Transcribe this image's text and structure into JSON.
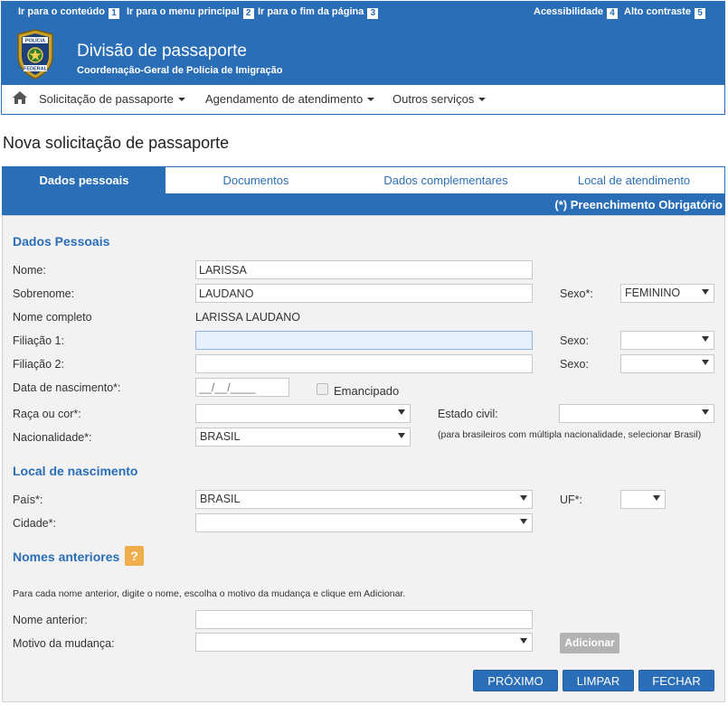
{
  "skip_links": [
    {
      "label": "Ir para o conteúdo",
      "key": "1"
    },
    {
      "label": "Ir para o menu principal",
      "key": "2"
    },
    {
      "label": "Ir para o fim da página",
      "key": "3"
    }
  ],
  "accessibility": {
    "label": "Acessibilidade",
    "key": "4",
    "contrast_label": "Alto contraste",
    "contrast_key": "5"
  },
  "header": {
    "title": "Divisão de passaporte",
    "subtitle": "Coordenação-Geral de Polícia de Imigração",
    "badge_top": "POLÍCIA",
    "badge_bottom": "FEDERAL"
  },
  "nav": {
    "items": [
      "Solicitação de passaporte",
      "Agendamento de atendimento",
      "Outros serviços"
    ]
  },
  "page_title": "Nova solicitação de passaporte",
  "tabs": [
    "Dados pessoais",
    "Documentos",
    "Dados complementares",
    "Local de atendimento"
  ],
  "required_note": "(*) Preenchimento Obrigatório",
  "sections": {
    "personal": "Dados Pessoais",
    "birthplace": "Local de nascimento",
    "previous_names": "Nomes anteriores"
  },
  "fields": {
    "nome": {
      "label": "Nome:",
      "value": "LARISSA"
    },
    "sobrenome": {
      "label": "Sobrenome:",
      "value": "LAUDANO"
    },
    "sexo": {
      "label": "Sexo*:",
      "value": "FEMININO"
    },
    "nome_completo": {
      "label": "Nome completo",
      "value": "LARISSA LAUDANO"
    },
    "filiacao1": {
      "label": "Filiação 1:",
      "value": ""
    },
    "sexo_f1": {
      "label": "Sexo:",
      "value": ""
    },
    "filiacao2": {
      "label": "Filiação 2:",
      "value": ""
    },
    "sexo_f2": {
      "label": "Sexo:",
      "value": ""
    },
    "nascimento": {
      "label": "Data de nascimento*:",
      "placeholder": "__/__/____"
    },
    "emancipado": {
      "label": "Emancipado"
    },
    "raca": {
      "label": "Raça ou cor*:",
      "value": ""
    },
    "estado_civil": {
      "label": "Estado civil:",
      "value": ""
    },
    "nacionalidade": {
      "label": "Nacionalidade*:",
      "value": "BRASIL",
      "note": "(para brasileiros com múltipla nacionalidade, selecionar Brasil)"
    },
    "pais": {
      "label": "País*:",
      "value": "BRASIL"
    },
    "uf": {
      "label": "UF*:",
      "value": ""
    },
    "cidade": {
      "label": "Cidade*:",
      "value": ""
    },
    "nome_anterior": {
      "label": "Nome anterior:",
      "value": ""
    },
    "motivo": {
      "label": "Motivo da mudança:",
      "value": ""
    }
  },
  "previous_names_instructions": "Para cada nome anterior, digite o nome, escolha o motivo da mudança e clique em Adicionar.",
  "help_icon": "?",
  "buttons": {
    "add": "Adicionar",
    "next": "PRÓXIMO",
    "clear": "LIMPAR",
    "close": "FECHAR"
  },
  "colors": {
    "primary": "#2a6eb7",
    "help": "#f0ad4e",
    "panel": "#f2f2f2"
  }
}
